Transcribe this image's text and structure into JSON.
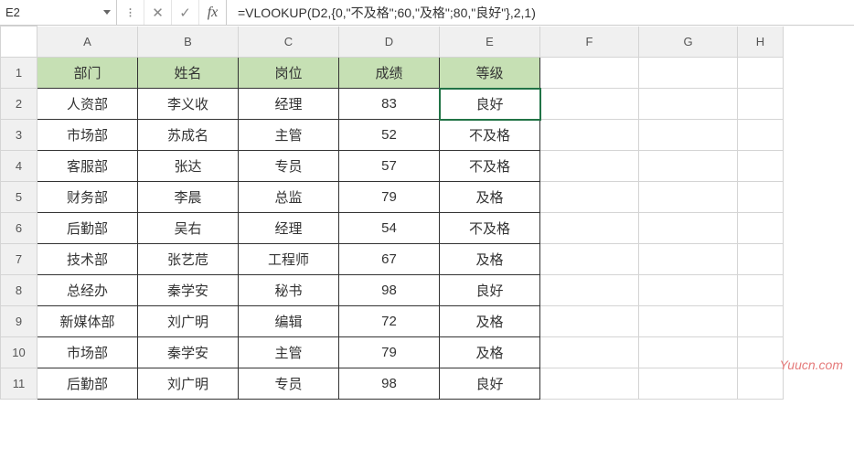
{
  "name_box": "E2",
  "formula": "=VLOOKUP(D2,{0,\"不及格\";60,\"及格\";80,\"良好\"},2,1)",
  "columns": [
    "A",
    "B",
    "C",
    "D",
    "E",
    "F",
    "G",
    "H"
  ],
  "row_labels": [
    "1",
    "2",
    "3",
    "4",
    "5",
    "6",
    "7",
    "8",
    "9",
    "10",
    "11"
  ],
  "headers": {
    "A": "部门",
    "B": "姓名",
    "C": "岗位",
    "D": "成绩",
    "E": "等级"
  },
  "rows": [
    {
      "A": "人资部",
      "B": "李义收",
      "C": "经理",
      "D": "83",
      "E": "良好"
    },
    {
      "A": "市场部",
      "B": "苏成名",
      "C": "主管",
      "D": "52",
      "E": "不及格"
    },
    {
      "A": "客服部",
      "B": "张达",
      "C": "专员",
      "D": "57",
      "E": "不及格"
    },
    {
      "A": "财务部",
      "B": "李晨",
      "C": "总监",
      "D": "79",
      "E": "及格"
    },
    {
      "A": "后勤部",
      "B": "吴右",
      "C": "经理",
      "D": "54",
      "E": "不及格"
    },
    {
      "A": "技术部",
      "B": "张艺苊",
      "C": "工程师",
      "D": "67",
      "E": "及格"
    },
    {
      "A": "总经办",
      "B": "秦学安",
      "C": "秘书",
      "D": "98",
      "E": "良好"
    },
    {
      "A": "新媒体部",
      "B": "刘广明",
      "C": "编辑",
      "D": "72",
      "E": "及格"
    },
    {
      "A": "市场部",
      "B": "秦学安",
      "C": "主管",
      "D": "79",
      "E": "及格"
    },
    {
      "A": "后勤部",
      "B": "刘广明",
      "C": "专员",
      "D": "98",
      "E": "良好"
    }
  ],
  "watermark": "Yuucn.com"
}
